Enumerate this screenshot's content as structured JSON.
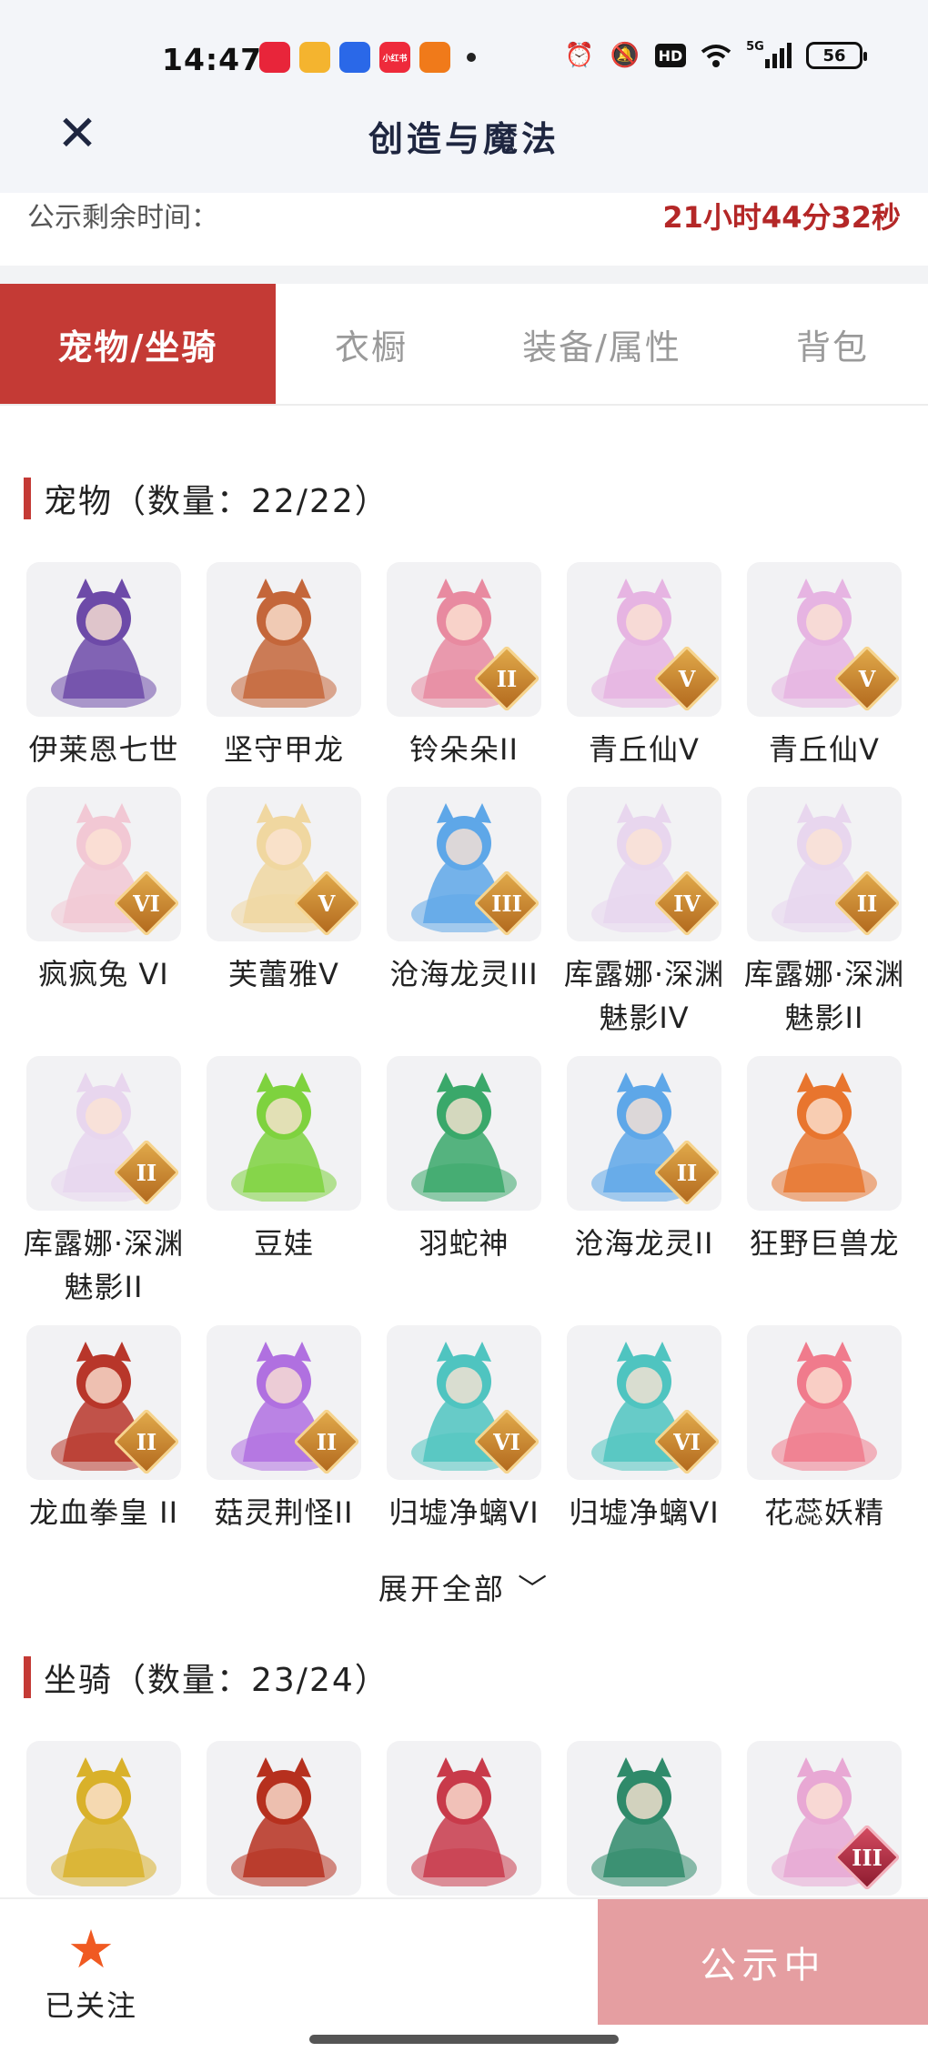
{
  "status_bar": {
    "time": "14:47",
    "app_icons": [
      {
        "name": "app-video-icon",
        "color": "#e8253a",
        "label": ""
      },
      {
        "name": "app-media-icon",
        "color": "#f4b42f",
        "label": ""
      },
      {
        "name": "app-circle-icon",
        "color": "#2a68e8",
        "label": ""
      },
      {
        "name": "xiaohongshu-icon",
        "color": "#ee2a3b",
        "label": "小红书"
      },
      {
        "name": "app-person-icon",
        "color": "#f07a1a",
        "label": ""
      }
    ],
    "hd_label": "HD",
    "signal_label": "5G",
    "battery": "56"
  },
  "header": {
    "title": "创造与魔法",
    "close_glyph": "✕"
  },
  "timer": {
    "label": "公示剩余时间：",
    "value": "21小时44分32秒"
  },
  "tabs": [
    {
      "label": "宠物/坐骑",
      "active": true
    },
    {
      "label": "衣橱",
      "active": false
    },
    {
      "label": "装备/属性",
      "active": false
    },
    {
      "label": "背包",
      "active": false
    }
  ],
  "pets_section": {
    "title": "宠物（数量：22/22）",
    "items": [
      {
        "name": "伊莱恩七世",
        "art": "#6d4aa8",
        "badge": ""
      },
      {
        "name": "坚守甲龙",
        "art": "#c4663a",
        "badge": ""
      },
      {
        "name": "铃朵朵II",
        "art": "#e88aa0",
        "badge": "II"
      },
      {
        "name": "青丘仙V",
        "art": "#e6b4e2",
        "badge": "V"
      },
      {
        "name": "青丘仙V",
        "art": "#e6b4e2",
        "badge": "V"
      },
      {
        "name": "疯疯兔 VI",
        "art": "#f2c8d4",
        "badge": "VI"
      },
      {
        "name": "芙蕾雅V",
        "art": "#f0d7a0",
        "badge": "V"
      },
      {
        "name": "沧海龙灵III",
        "art": "#5ea7e8",
        "badge": "III"
      },
      {
        "name": "库露娜·深渊魅影IV",
        "art": "#e8d6ee",
        "badge": "IV"
      },
      {
        "name": "库露娜·深渊魅影II",
        "art": "#e8d6ee",
        "badge": "II"
      },
      {
        "name": "库露娜·深渊魅影II",
        "art": "#e8d6ee",
        "badge": "II"
      },
      {
        "name": "豆娃",
        "art": "#7ed23e",
        "badge": ""
      },
      {
        "name": "羽蛇神",
        "art": "#3aa86a",
        "badge": ""
      },
      {
        "name": "沧海龙灵II",
        "art": "#5ea7e8",
        "badge": "II"
      },
      {
        "name": "狂野巨兽龙",
        "art": "#e8752e",
        "badge": ""
      },
      {
        "name": "龙血拳皇 II",
        "art": "#b8362a",
        "badge": "II"
      },
      {
        "name": "菇灵荆怪II",
        "art": "#b070e0",
        "badge": "II"
      },
      {
        "name": "归墟净螭VI",
        "art": "#4fc4c0",
        "badge": "VI"
      },
      {
        "name": "归墟净螭VI",
        "art": "#4fc4c0",
        "badge": "VI"
      },
      {
        "name": "花蕊妖精",
        "art": "#f07b8c",
        "badge": ""
      }
    ]
  },
  "expand_label": "展开全部 ﹀",
  "mounts_section": {
    "title": "坐骑（数量：23/24）",
    "items": [
      {
        "art": "#d9b12a",
        "badge": ""
      },
      {
        "art": "#b6301e",
        "badge": ""
      },
      {
        "art": "#c83a4a",
        "badge": ""
      },
      {
        "art": "#2f8a6a",
        "badge": ""
      },
      {
        "art": "#e8a8d4",
        "badge": "III"
      }
    ]
  },
  "bottom": {
    "follow_label": "已关注",
    "follow_icon": "★",
    "publicity_label": "公示中"
  }
}
